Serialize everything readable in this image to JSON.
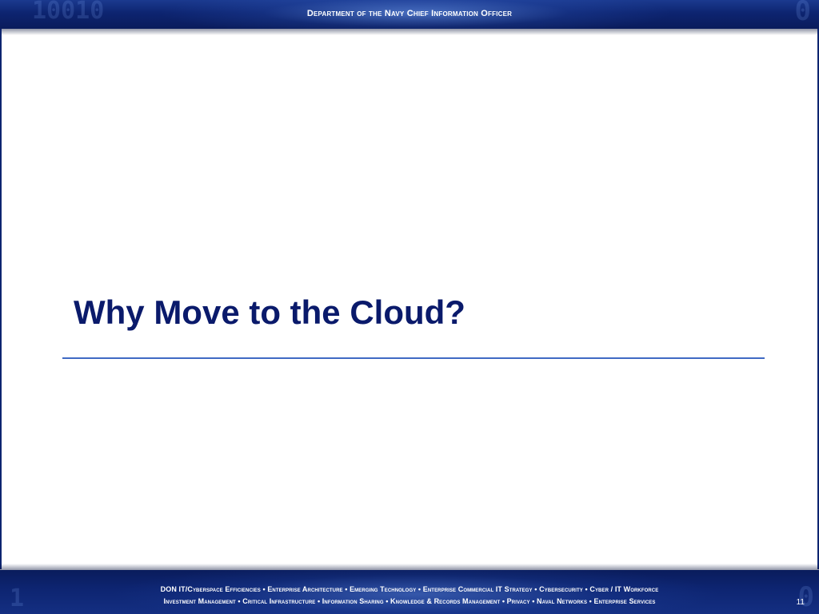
{
  "header": {
    "title": "Department of the Navy Chief Information Officer",
    "decoration_left": "10010",
    "decoration_right": "0"
  },
  "slide": {
    "title": "Why Move to the Cloud?",
    "title_color": "#0a1a6b",
    "rule_color": "#3f6ac4"
  },
  "footer": {
    "line1": "DON IT/Cyberspace  Efficiencies  •  Enterprise Architecture  •  Emerging Technology  •  Enterprise Commercial IT Strategy  •  Cybersecurity  •  Cyber / IT Workforce",
    "line2": "Investment Management  •  Critical Infrastructure  •  Information Sharing  •  Knowledge & Records Management  •  Privacy  •  Naval Networks  •  Enterprise Services",
    "page_number": "11",
    "decoration_left": "1",
    "decoration_right": "0"
  },
  "colors": {
    "banner_dark": "#0a1c5c",
    "banner_mid": "#0d2470",
    "banner_light": "#1b3a8f"
  }
}
